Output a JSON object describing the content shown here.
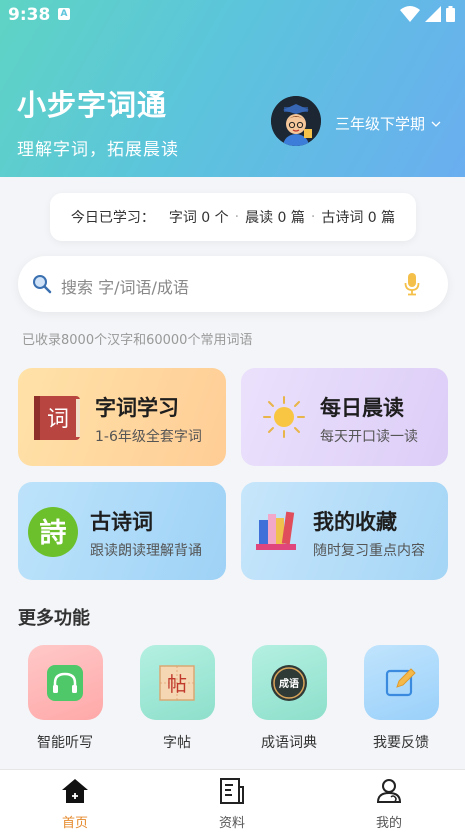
{
  "status": {
    "time": "9:38",
    "notification_icon": "A"
  },
  "header": {
    "title": "小步字词通",
    "subtitle": "理解字词，拓展晨读",
    "grade": "三年级下学期"
  },
  "today": {
    "label": "今日已学习：",
    "words": "字词 0 个",
    "reading": "晨读 0 篇",
    "poems": "古诗词 0 篇"
  },
  "search": {
    "placeholder": "搜索 字/词语/成语",
    "collected": "已收录8000个汉字和60000个常用词语"
  },
  "cards": [
    {
      "title": "字词学习",
      "subtitle": "1-6年级全套字词",
      "icon": "book-ci-icon"
    },
    {
      "title": "每日晨读",
      "subtitle": "每天开口读一读",
      "icon": "sun-icon"
    },
    {
      "title": "古诗词",
      "subtitle": "跟读朗读理解背诵",
      "icon": "poem-shi-icon"
    },
    {
      "title": "我的收藏",
      "subtitle": "随时复习重点内容",
      "icon": "books-icon"
    }
  ],
  "more": {
    "title": "更多功能",
    "items": [
      {
        "label": "智能听写",
        "icon": "headphones-icon",
        "color": "#ffb5b5"
      },
      {
        "label": "字帖",
        "icon": "copybook-icon",
        "color": "#9ee6d6"
      },
      {
        "label": "成语词典",
        "icon": "idiom-dictionary-icon",
        "color": "#9ee6d6"
      },
      {
        "label": "我要反馈",
        "icon": "edit-feedback-icon",
        "color": "#a9d8fb"
      }
    ]
  },
  "icon_glyphs": {
    "ci": "词",
    "shi": "詩",
    "tie": "帖",
    "chengyu": "成语"
  },
  "tabs": [
    {
      "label": "首页",
      "icon": "home-icon",
      "active": true
    },
    {
      "label": "资料",
      "icon": "document-icon",
      "active": false
    },
    {
      "label": "我的",
      "icon": "user-icon",
      "active": false
    }
  ],
  "colors": {
    "accent": "#e58a2c",
    "header_start": "#5fd4c4",
    "header_end": "#6aaef0"
  }
}
